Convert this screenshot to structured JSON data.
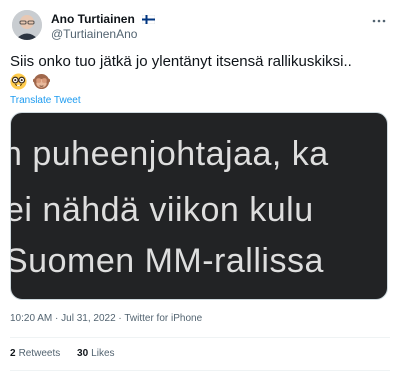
{
  "author": {
    "display_name": "Ano Turtiainen",
    "handle": "@TurtiainenAno",
    "flag": "finland-flag-icon"
  },
  "tweet": {
    "text": "Siis onko tuo jätkä jo ylentänyt itsensä rallikuskiksi..",
    "emojis": [
      "nerd-face-icon",
      "see-no-evil-monkey-icon"
    ],
    "translate_label": "Translate Tweet"
  },
  "media": {
    "lines": [
      "n puheenjohtajaa, ka",
      "ei nähdä viikon kulu",
      "Suomen MM-rallissa"
    ]
  },
  "meta": {
    "timestamp": "10:20 AM · Jul 31, 2022 · Twitter for iPhone"
  },
  "stats": {
    "retweets_count": "2",
    "retweets_label": "Retweets",
    "likes_count": "30",
    "likes_label": "Likes"
  },
  "colors": {
    "link": "#1d9bf0",
    "secondary_text": "#536471",
    "media_background": "#222325"
  }
}
